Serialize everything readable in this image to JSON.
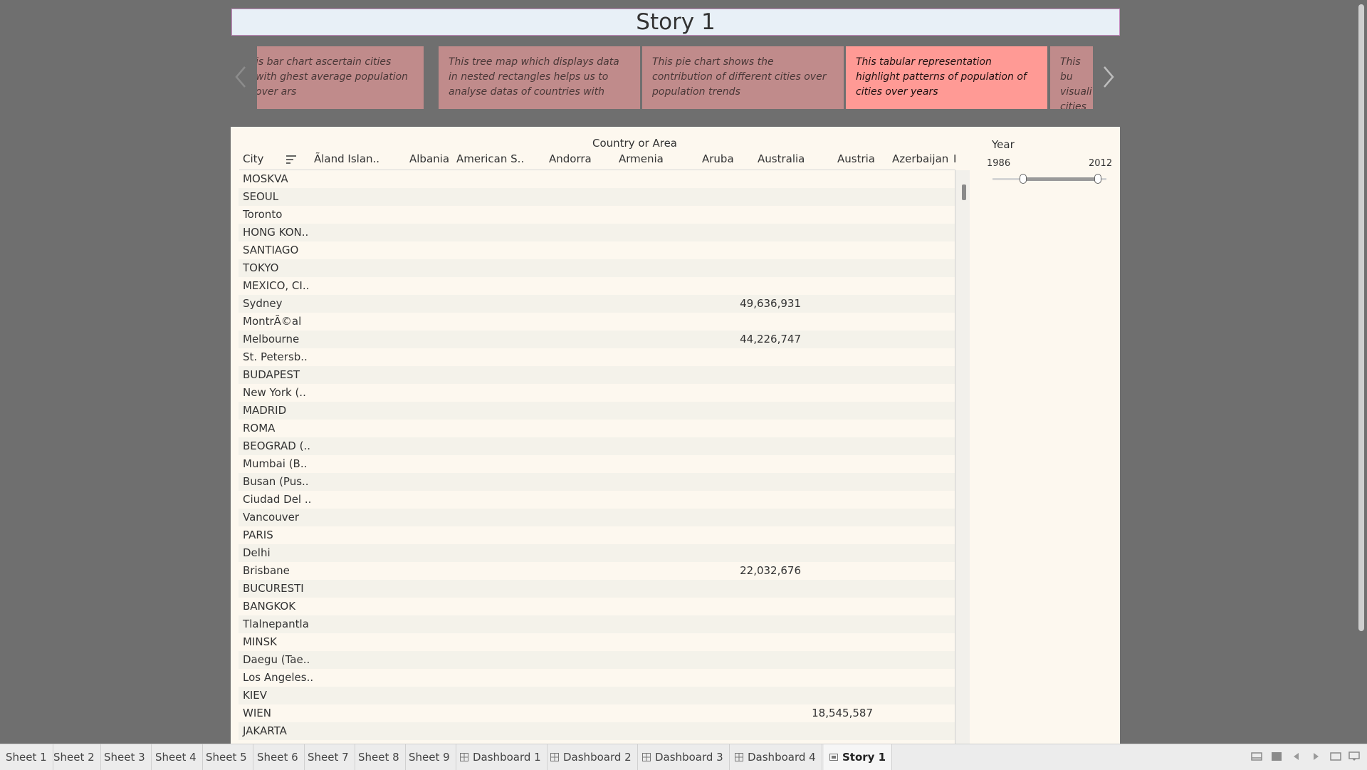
{
  "story": {
    "title": "Story 1"
  },
  "captions": [
    "is bar chart ascertain cities with ghest average population over ars",
    "This tree map which displays data in nested rectangles  helps us to analyse datas of countries with",
    "This pie chart shows the contribution of different cities over population trends",
    "This tabular representation highlight  patterns of population of cities over years",
    "This bu visuali cities"
  ],
  "table": {
    "column_group_label": "Country or Area",
    "row_header": "City",
    "columns": [
      "Ãland Islan..",
      "Albania",
      "American S..",
      "Andorra",
      "Armenia",
      "Aruba",
      "Australia",
      "Austria",
      "Azerbaijan",
      "I"
    ],
    "rows": [
      {
        "city": "MOSKVA",
        "australia": "",
        "austria": ""
      },
      {
        "city": "SEOUL",
        "australia": "",
        "austria": ""
      },
      {
        "city": "Toronto",
        "australia": "",
        "austria": ""
      },
      {
        "city": "HONG KON..",
        "australia": "",
        "austria": ""
      },
      {
        "city": "SANTIAGO",
        "australia": "",
        "austria": ""
      },
      {
        "city": "TOKYO",
        "australia": "",
        "austria": ""
      },
      {
        "city": "MEXICO, CI..",
        "australia": "",
        "austria": ""
      },
      {
        "city": "Sydney",
        "australia": "49,636,931",
        "austria": ""
      },
      {
        "city": "MontrÃ©al",
        "australia": "",
        "austria": ""
      },
      {
        "city": "Melbourne",
        "australia": "44,226,747",
        "austria": ""
      },
      {
        "city": "St. Petersb..",
        "australia": "",
        "austria": ""
      },
      {
        "city": "BUDAPEST",
        "australia": "",
        "austria": ""
      },
      {
        "city": "New York (..",
        "australia": "",
        "austria": ""
      },
      {
        "city": "MADRID",
        "australia": "",
        "austria": ""
      },
      {
        "city": "ROMA",
        "australia": "",
        "austria": ""
      },
      {
        "city": "BEOGRAD (..",
        "australia": "",
        "austria": ""
      },
      {
        "city": "Mumbai (B..",
        "australia": "",
        "austria": ""
      },
      {
        "city": "Busan (Pus..",
        "australia": "",
        "austria": ""
      },
      {
        "city": "Ciudad Del ..",
        "australia": "",
        "austria": ""
      },
      {
        "city": "Vancouver",
        "australia": "",
        "austria": ""
      },
      {
        "city": "PARIS",
        "australia": "",
        "austria": ""
      },
      {
        "city": "Delhi",
        "australia": "",
        "austria": ""
      },
      {
        "city": "Brisbane",
        "australia": "22,032,676",
        "austria": ""
      },
      {
        "city": "BUCURESTI",
        "australia": "",
        "austria": ""
      },
      {
        "city": "BANGKOK",
        "australia": "",
        "austria": ""
      },
      {
        "city": "Tlalnepantla",
        "australia": "",
        "austria": ""
      },
      {
        "city": "MINSK",
        "australia": "",
        "austria": ""
      },
      {
        "city": "Daegu (Tae..",
        "australia": "",
        "austria": ""
      },
      {
        "city": "Los Angeles..",
        "australia": "",
        "austria": ""
      },
      {
        "city": "KIEV",
        "australia": "",
        "austria": ""
      },
      {
        "city": "WIEN",
        "australia": "",
        "austria": "18,545,587"
      },
      {
        "city": "JAKARTA",
        "australia": "",
        "austria": ""
      }
    ]
  },
  "filter": {
    "title": "Year",
    "min": "1986",
    "max": "2012"
  },
  "tabs": [
    {
      "label": "Sheet 1",
      "icon": ""
    },
    {
      "label": "Sheet 2",
      "icon": ""
    },
    {
      "label": "Sheet 3",
      "icon": ""
    },
    {
      "label": "Sheet 4",
      "icon": ""
    },
    {
      "label": "Sheet 5",
      "icon": ""
    },
    {
      "label": "Sheet 6",
      "icon": ""
    },
    {
      "label": "Sheet 7",
      "icon": ""
    },
    {
      "label": "Sheet 8",
      "icon": ""
    },
    {
      "label": "Sheet 9",
      "icon": ""
    },
    {
      "label": "Dashboard 1",
      "icon": "dashboard-icon"
    },
    {
      "label": "Dashboard 2",
      "icon": "dashboard-icon"
    },
    {
      "label": "Dashboard 3",
      "icon": "dashboard-icon"
    },
    {
      "label": "Dashboard 4",
      "icon": "dashboard-icon"
    },
    {
      "label": "Story 1",
      "icon": "story-icon",
      "active": true
    }
  ],
  "colors": {
    "caption": "#c08b8b",
    "caption_active": "#ff9a95",
    "title_bg": "#e8f0f7",
    "sheet_bg": "#fdf8ef"
  }
}
